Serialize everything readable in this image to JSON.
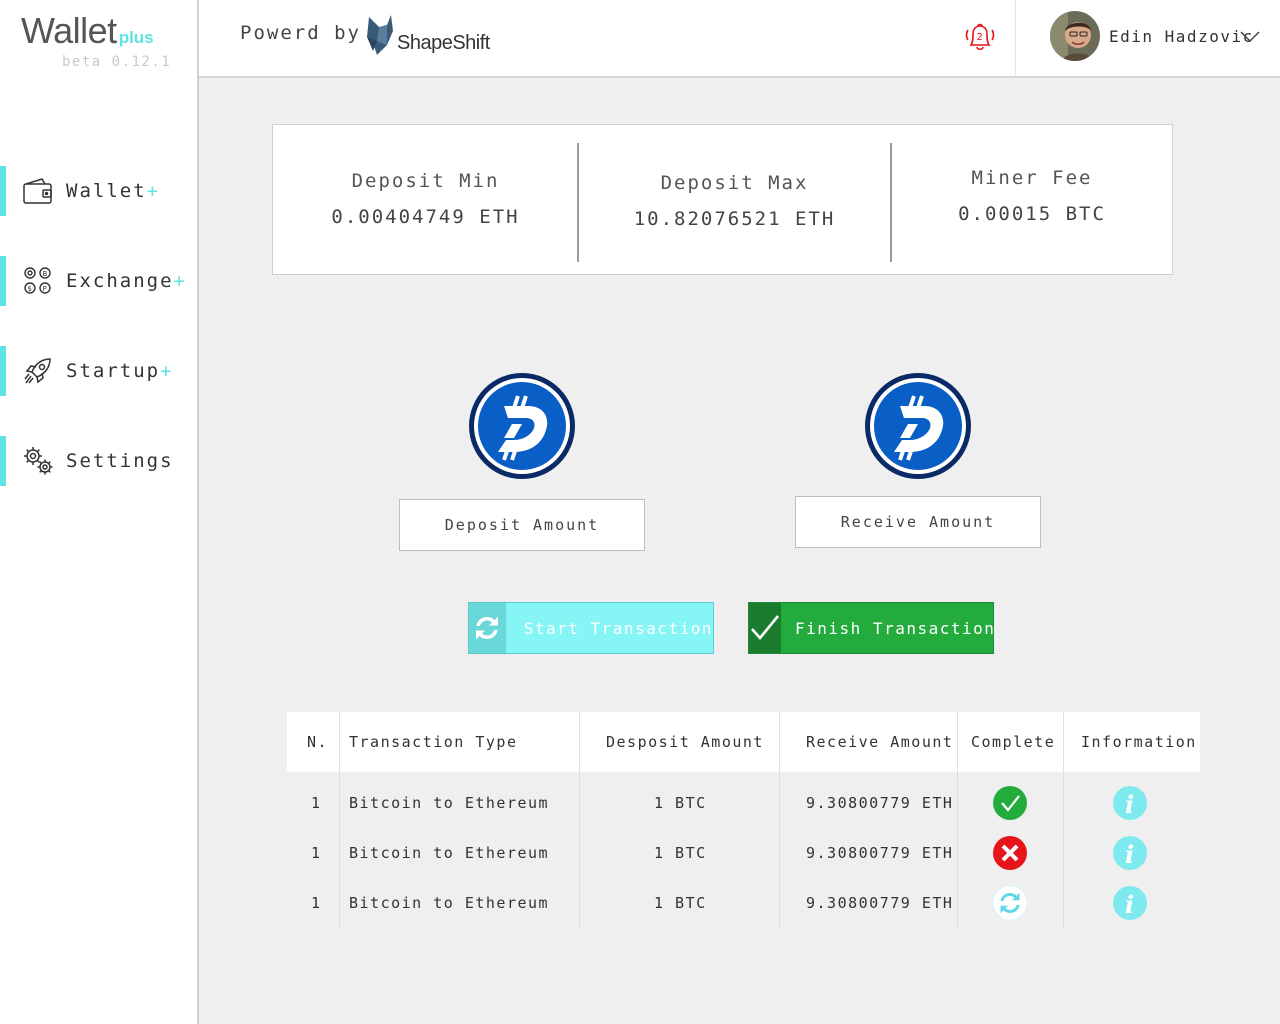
{
  "sidebar": {
    "logo_main": "Wallet",
    "logo_sub": "plus",
    "version": "beta 0.12.1",
    "items": [
      {
        "label": "Wallet",
        "suffix": "+"
      },
      {
        "label": "Exchange",
        "suffix": "+"
      },
      {
        "label": "Startup",
        "suffix": "+"
      },
      {
        "label": "Settings",
        "suffix": ""
      }
    ]
  },
  "header": {
    "powered_by": "Powerd by",
    "partner": "ShapeShift",
    "notification_count": "2",
    "user_name": "Edin Hadzovic"
  },
  "limits": {
    "deposit_min_label": "Deposit Min",
    "deposit_min_value": "0.00404749 ETH",
    "deposit_max_label": "Deposit Max",
    "deposit_max_value": "10.82076521 ETH",
    "miner_fee_label": "Miner Fee",
    "miner_fee_value": "0.00015 BTC"
  },
  "exchange": {
    "deposit_button": "Deposit Amount",
    "receive_button": "Receive Amount",
    "start_button": "Start Transaction",
    "finish_button": "Finish Transaction"
  },
  "table": {
    "headers": [
      "N.",
      "Transaction Type",
      "Desposit Amount",
      "Receive Amount",
      "Complete",
      "Information"
    ],
    "rows": [
      {
        "n": "1",
        "type": "Bitcoin to Ethereum",
        "deposit": "1 BTC",
        "receive": "9.30800779 ETH",
        "status": "complete"
      },
      {
        "n": "1",
        "type": "Bitcoin to Ethereum",
        "deposit": "1 BTC",
        "receive": "9.30800779 ETH",
        "status": "failed"
      },
      {
        "n": "1",
        "type": "Bitcoin to Ethereum",
        "deposit": "1 BTC",
        "receive": "9.30800779 ETH",
        "status": "pending"
      }
    ]
  },
  "colors": {
    "accent": "#5fe3e3",
    "success": "#23ab3e",
    "danger": "#e8141b",
    "info": "#7fe9f0",
    "digibyte": "#0a5fc6"
  }
}
